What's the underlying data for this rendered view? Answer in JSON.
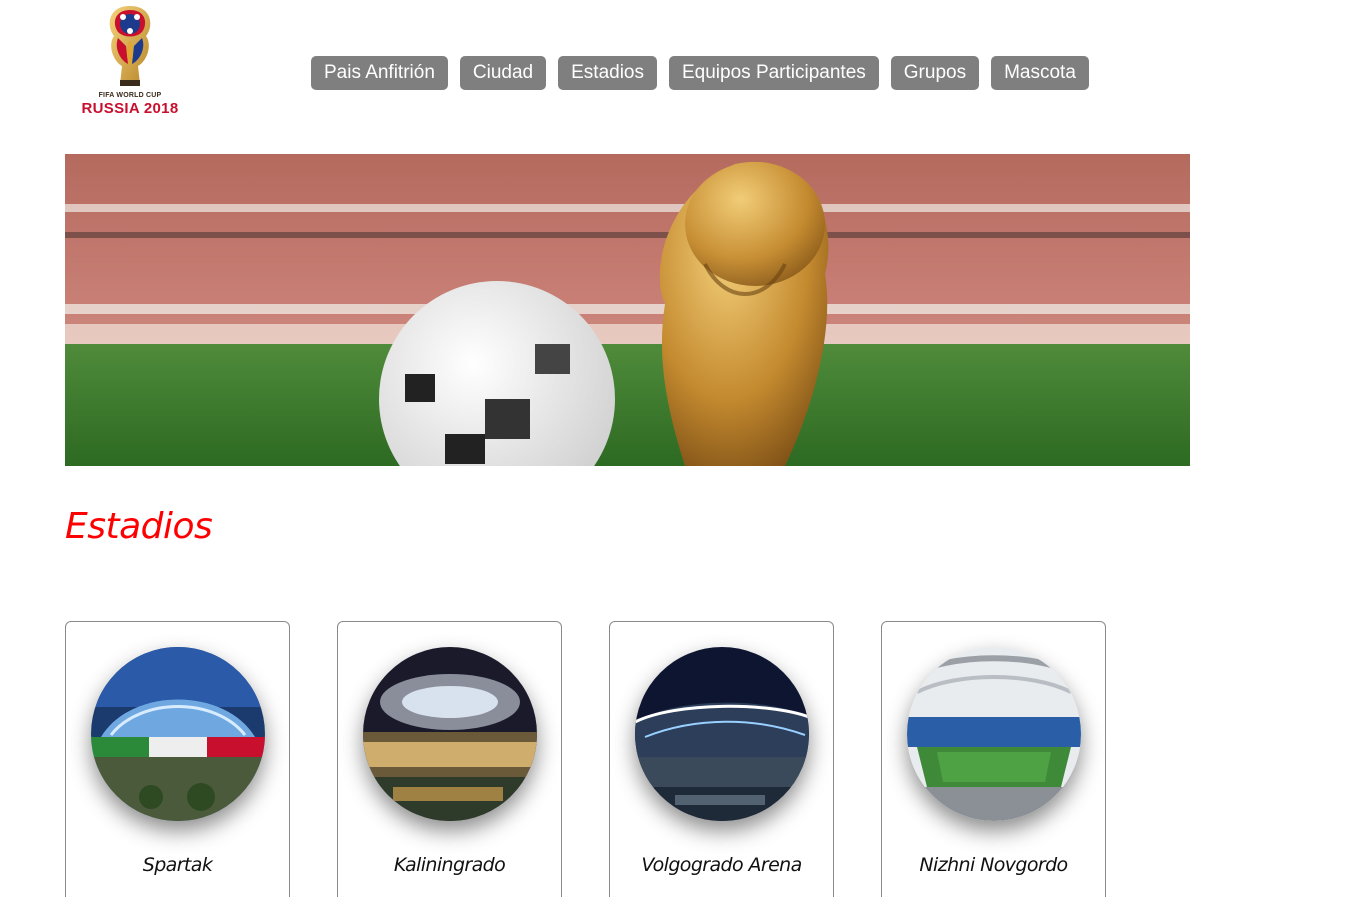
{
  "logo": {
    "small_text": "FIFA WORLD CUP",
    "big_text": "RUSSIA 2018"
  },
  "nav": {
    "items": [
      {
        "label": "Pais Anfitrión"
      },
      {
        "label": "Ciudad"
      },
      {
        "label": "Estadios"
      },
      {
        "label": "Equipos Participantes"
      },
      {
        "label": "Grupos"
      },
      {
        "label": "Mascota"
      }
    ]
  },
  "section": {
    "title": "Estadios"
  },
  "stadiums": [
    {
      "name": "Spartak"
    },
    {
      "name": "Kaliningrado"
    },
    {
      "name": "Volgogrado Arena"
    },
    {
      "name": "Nizhni Novgordo"
    }
  ],
  "colors": {
    "nav_bg": "#7f7f7f",
    "title": "#ff0000",
    "brand_red": "#c8102e"
  }
}
